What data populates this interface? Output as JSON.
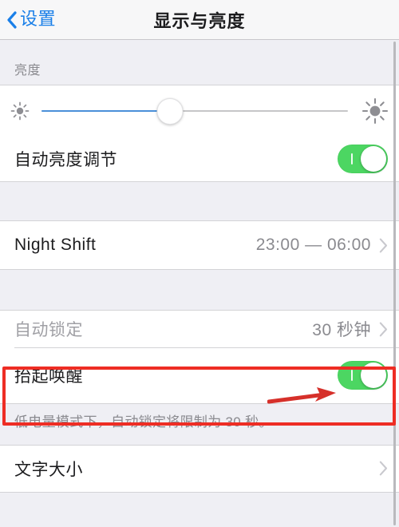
{
  "navbar": {
    "back_label": "设置",
    "back_icon": "chevron-left-icon",
    "title": "显示与亮度"
  },
  "brightness_section": {
    "header": "亮度",
    "slider": {
      "icon_low": "sun-small-icon",
      "icon_high": "sun-large-icon",
      "value_percent": 42,
      "fill_color": "#4a90d9",
      "track_color": "#c6c6c8"
    },
    "auto_brightness": {
      "label": "自动亮度调节",
      "toggle_state": "on",
      "toggle_color": "#4cd662"
    }
  },
  "night_shift_section": {
    "rows": [
      {
        "label": "Night Shift",
        "value": "23:00 — 06:00",
        "accessory": "chevron-right-icon"
      }
    ]
  },
  "lock_section": {
    "auto_lock": {
      "label": "自动锁定",
      "value": "30 秒钟",
      "accessory": "chevron-right-icon",
      "state": "disabled"
    },
    "raise_to_wake": {
      "label": "抬起唤醒",
      "toggle_state": "on",
      "toggle_color": "#4cd662"
    },
    "footer_note": "低电量模式下，自动锁定将限制为 30 秒。"
  },
  "text_section": {
    "rows": [
      {
        "label": "文字大小",
        "value": "",
        "accessory": "chevron-right-icon"
      }
    ]
  },
  "annotation": {
    "highlight_color": "#ee2d24",
    "arrow_color": "#d6302a",
    "target": "抬起唤醒"
  }
}
